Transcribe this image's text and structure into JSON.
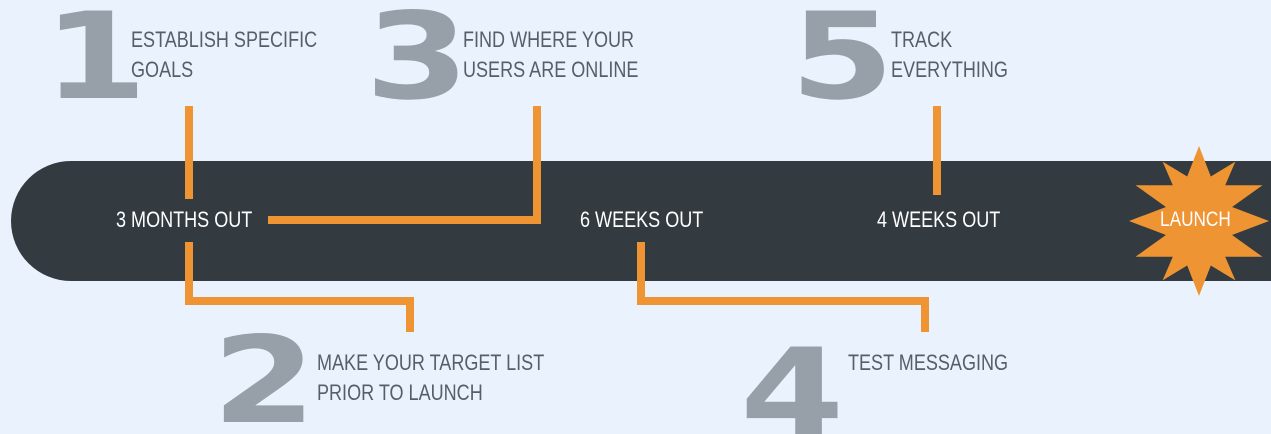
{
  "steps": [
    {
      "number": "1",
      "line1": "ESTABLISH SPECIFIC",
      "line2": "GOALS"
    },
    {
      "number": "2",
      "line1": "MAKE YOUR TARGET LIST",
      "line2": "PRIOR TO LAUNCH"
    },
    {
      "number": "3",
      "line1": "FIND WHERE YOUR",
      "line2": "USERS ARE ONLINE"
    },
    {
      "number": "4",
      "line1": "TEST MESSAGING",
      "line2": ""
    },
    {
      "number": "5",
      "line1": "TRACK",
      "line2": "EVERYTHING"
    }
  ],
  "timeline": {
    "labels": [
      "3 MONTHS OUT",
      "6 WEEKS OUT",
      "4 WEEKS OUT"
    ],
    "launch": "LAUNCH"
  },
  "colors": {
    "background": "#eaf3fd",
    "bar": "#333a40",
    "connector": "#ef9433",
    "burst": "#ef9433",
    "number": "#97a0a8",
    "text": "#555f68"
  }
}
